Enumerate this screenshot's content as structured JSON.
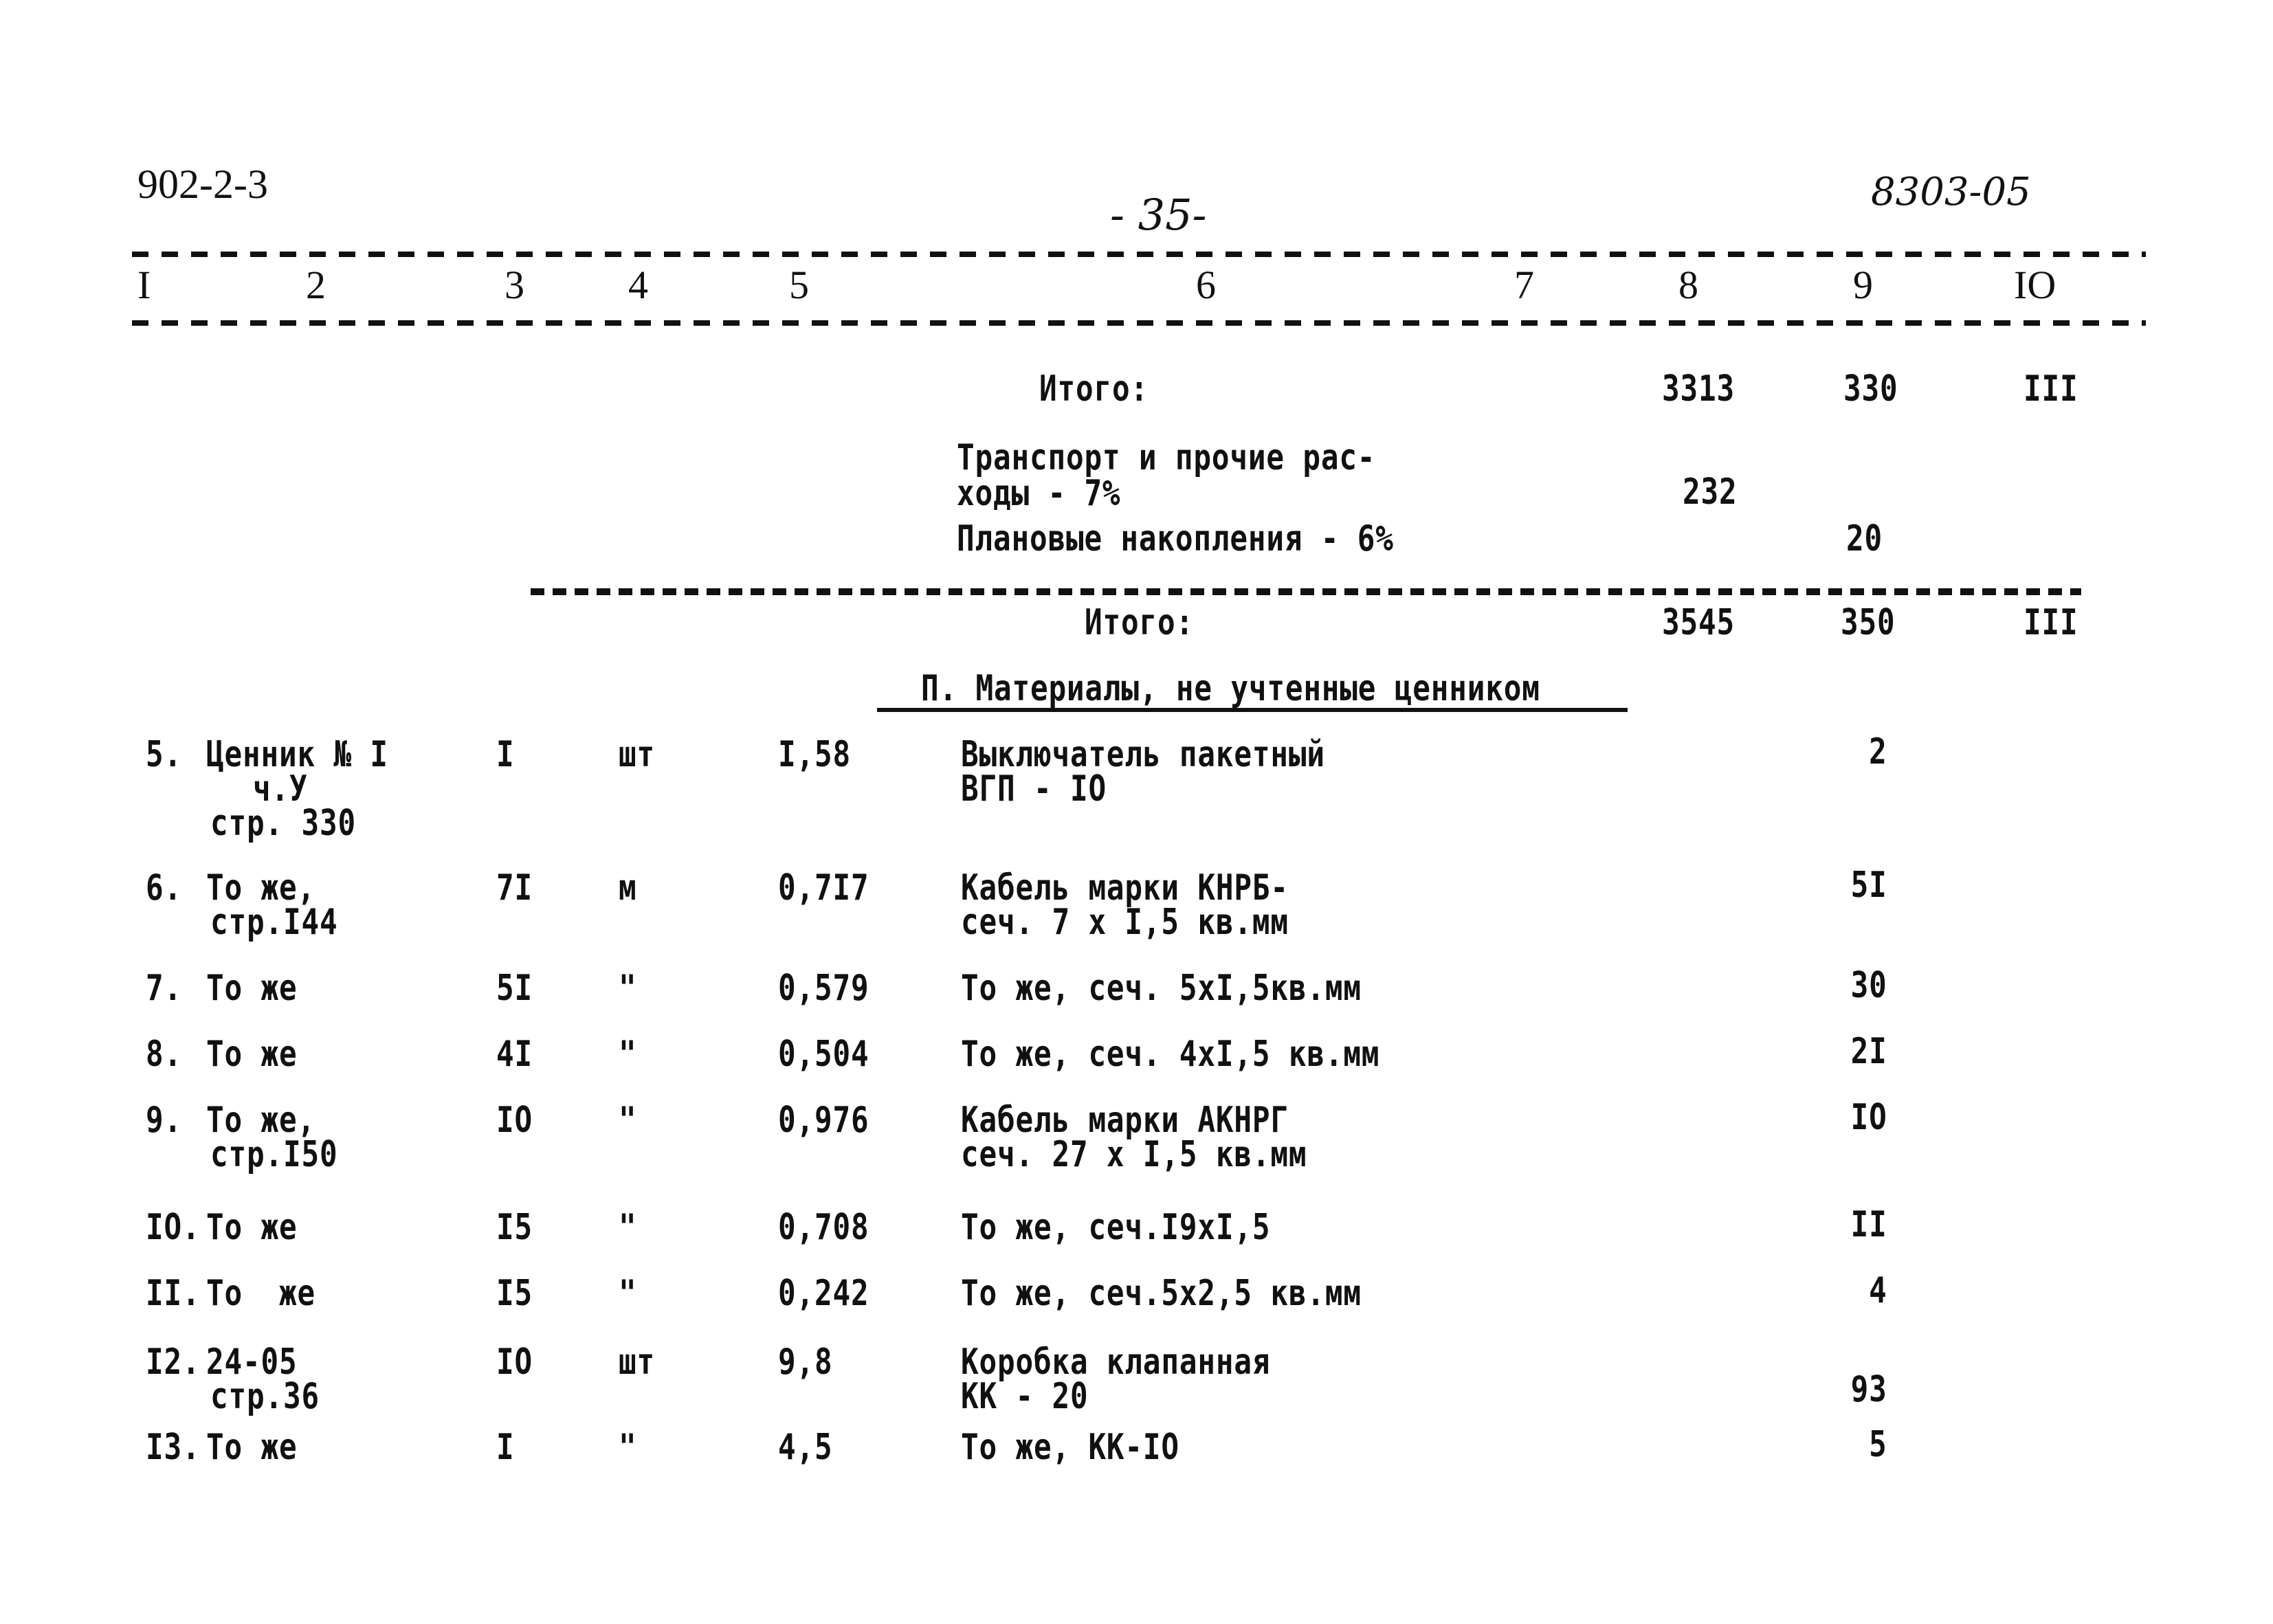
{
  "header": {
    "doc_code": "902-2-3",
    "page_number": "- 35-",
    "project_code": "8303-05"
  },
  "columns": [
    "I",
    "2",
    "3",
    "4",
    "5",
    "6",
    "7",
    "8",
    "9",
    "IO"
  ],
  "totals_block": {
    "subtotal_1": {
      "label": "Итого:",
      "col8": "3313",
      "col9": "330",
      "col10": "III"
    },
    "transport": {
      "label_line1": "Транспорт и прочие рас-",
      "label_line2": "ходы - 7%",
      "col8": "232"
    },
    "planned": {
      "label": "Плановые накопления - 6%",
      "col9": "20"
    },
    "subtotal_2": {
      "label": "Итого:",
      "col8": "3545",
      "col9": "350",
      "col10": "III"
    }
  },
  "section_title": "П. Материалы, не учтенные ценником",
  "rows": [
    {
      "num": "5.",
      "source": [
        "Ценник № I",
        "ч.У",
        "стр. 330"
      ],
      "qty": "I",
      "unit": "шт",
      "price": "I,58",
      "desc": [
        "Выключатель пакетный",
        "ВГП - IO"
      ],
      "col9": "2"
    },
    {
      "num": "6.",
      "source": [
        "То же,",
        "стр.I44"
      ],
      "qty": "7I",
      "unit": "м",
      "price": "0,7I7",
      "desc": [
        "Кабель марки КНРБ-",
        "сеч. 7 х I,5 кв.мм"
      ],
      "col9": "5I"
    },
    {
      "num": "7.",
      "source": [
        "То же"
      ],
      "qty": "5I",
      "unit": "\"",
      "price": "0,579",
      "desc": [
        "То же, сеч. 5хI,5кв.мм"
      ],
      "col9": "30"
    },
    {
      "num": "8.",
      "source": [
        "То же"
      ],
      "qty": "4I",
      "unit": "\"",
      "price": "0,504",
      "desc": [
        "То же, сеч. 4хI,5 кв.мм"
      ],
      "col9": "2I"
    },
    {
      "num": "9.",
      "source": [
        "То же,",
        "стр.I50"
      ],
      "qty": "IO",
      "unit": "\"",
      "price": "0,976",
      "desc": [
        "Кабель марки АКНРГ",
        "сеч. 27 х I,5 кв.мм"
      ],
      "col9": "IO"
    },
    {
      "num": "IO.",
      "source": [
        "То же"
      ],
      "qty": "I5",
      "unit": "\"",
      "price": "0,708",
      "desc": [
        "То же, сеч.I9хI,5"
      ],
      "col9": "II"
    },
    {
      "num": "II.",
      "source": [
        "То  же"
      ],
      "qty": "I5",
      "unit": "\"",
      "price": "0,242",
      "desc": [
        "То же, сеч.5х2,5 кв.мм"
      ],
      "col9": "4"
    },
    {
      "num": "I2.",
      "source": [
        "24-05",
        "стр.36"
      ],
      "qty": "IO",
      "unit": "шт",
      "price": "9,8",
      "desc": [
        "Коробка клапанная",
        "КК - 20"
      ],
      "col9": "93"
    },
    {
      "num": "I3.",
      "source": [
        "То же"
      ],
      "qty": "I",
      "unit": "\"",
      "price": "4,5",
      "desc": [
        "То же, КК-IO"
      ],
      "col9": "5"
    }
  ]
}
